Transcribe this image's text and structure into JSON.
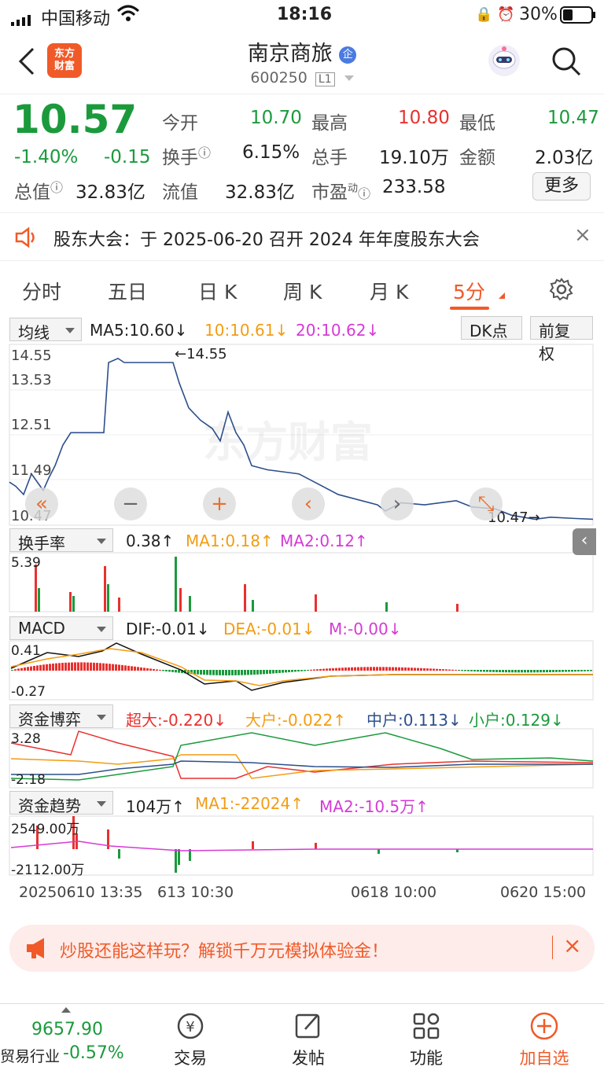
{
  "status": {
    "carrier": "中国移动",
    "time": "18:16",
    "battery": "30%"
  },
  "header": {
    "logo_text_1": "东方",
    "logo_text_2": "财富",
    "title": "南京商旅",
    "badge": "企",
    "code": "600250",
    "level": "L1"
  },
  "quote": {
    "price": "10.57",
    "pct": "-1.40%",
    "chg": "-0.15",
    "open_label": "今开",
    "open": "10.70",
    "high_label": "最高",
    "high": "10.80",
    "low_label": "最低",
    "low": "10.47",
    "turnover_label": "换手",
    "turnover": "6.15%",
    "vol_label": "总手",
    "vol": "19.10万",
    "amount_label": "金额",
    "amount": "2.03亿",
    "mktcap_label": "总值",
    "mktcap": "32.83亿",
    "float_label": "流值",
    "float": "32.83亿",
    "pe_label": "市盈",
    "pe_sup": "动",
    "pe": "233.58",
    "more": "更多"
  },
  "notice": {
    "text": "股东大会：于 2025-06-20 召开 2024 年年度股东大会"
  },
  "tabs": [
    "分时",
    "五日",
    "日 K",
    "周 K",
    "月 K",
    "5分"
  ],
  "main_chart": {
    "indicator": "均线",
    "ma5": "MA5:10.60↓",
    "ma10": "10:10.61↓",
    "ma20": "20:10.62↓",
    "dk": "DK点",
    "fq": "前复权",
    "y_labels": [
      "14.55",
      "13.53",
      "12.51",
      "11.49",
      "10.47"
    ],
    "max_label": "←14.55",
    "min_label": "10.47→",
    "watermark": "东方财富"
  },
  "turnover_chart": {
    "indicator": "换手率",
    "value": "0.38↑",
    "ma1": "MA1:0.18↑",
    "ma2": "MA2:0.12↑",
    "y_top": "5.39"
  },
  "macd_chart": {
    "indicator": "MACD",
    "dif": "DIF:-0.01↓",
    "dea": "DEA:-0.01↓",
    "m": "M:-0.00↓",
    "y_top": "0.41",
    "y_bot": "-0.27"
  },
  "fund_game": {
    "indicator": "资金博弈",
    "super": "超大:-0.220↓",
    "large": "大户:-0.022↑",
    "mid": "中户:0.113↓",
    "small": "小户:0.129↓",
    "y_top": "3.28",
    "y_bot": "-2.18"
  },
  "fund_trend": {
    "indicator": "资金趋势",
    "value": "104万↑",
    "ma1": "MA1:-22024↑",
    "ma2": "MA2:-10.5万↑",
    "y_top": "2549.00万",
    "y_bot": "-2112.00万"
  },
  "x_axis": [
    "20250610 13:35",
    "613 10:30",
    "0618 10:00",
    "0620 15:00"
  ],
  "ad": {
    "text": "炒股还能这样玩？解锁千万元模拟体验金！"
  },
  "bottom": {
    "index_value": "9657.90",
    "index_name": "贸易行业",
    "index_pct": "-0.57%",
    "items": [
      "交易",
      "发帖",
      "功能",
      "加自选"
    ]
  },
  "colors": {
    "red": "#e8312f",
    "green": "#1b9a3c",
    "orange": "#f39c12",
    "accent": "#f05a28",
    "blue": "#2c4f8c",
    "magenta": "#d63ad6"
  }
}
